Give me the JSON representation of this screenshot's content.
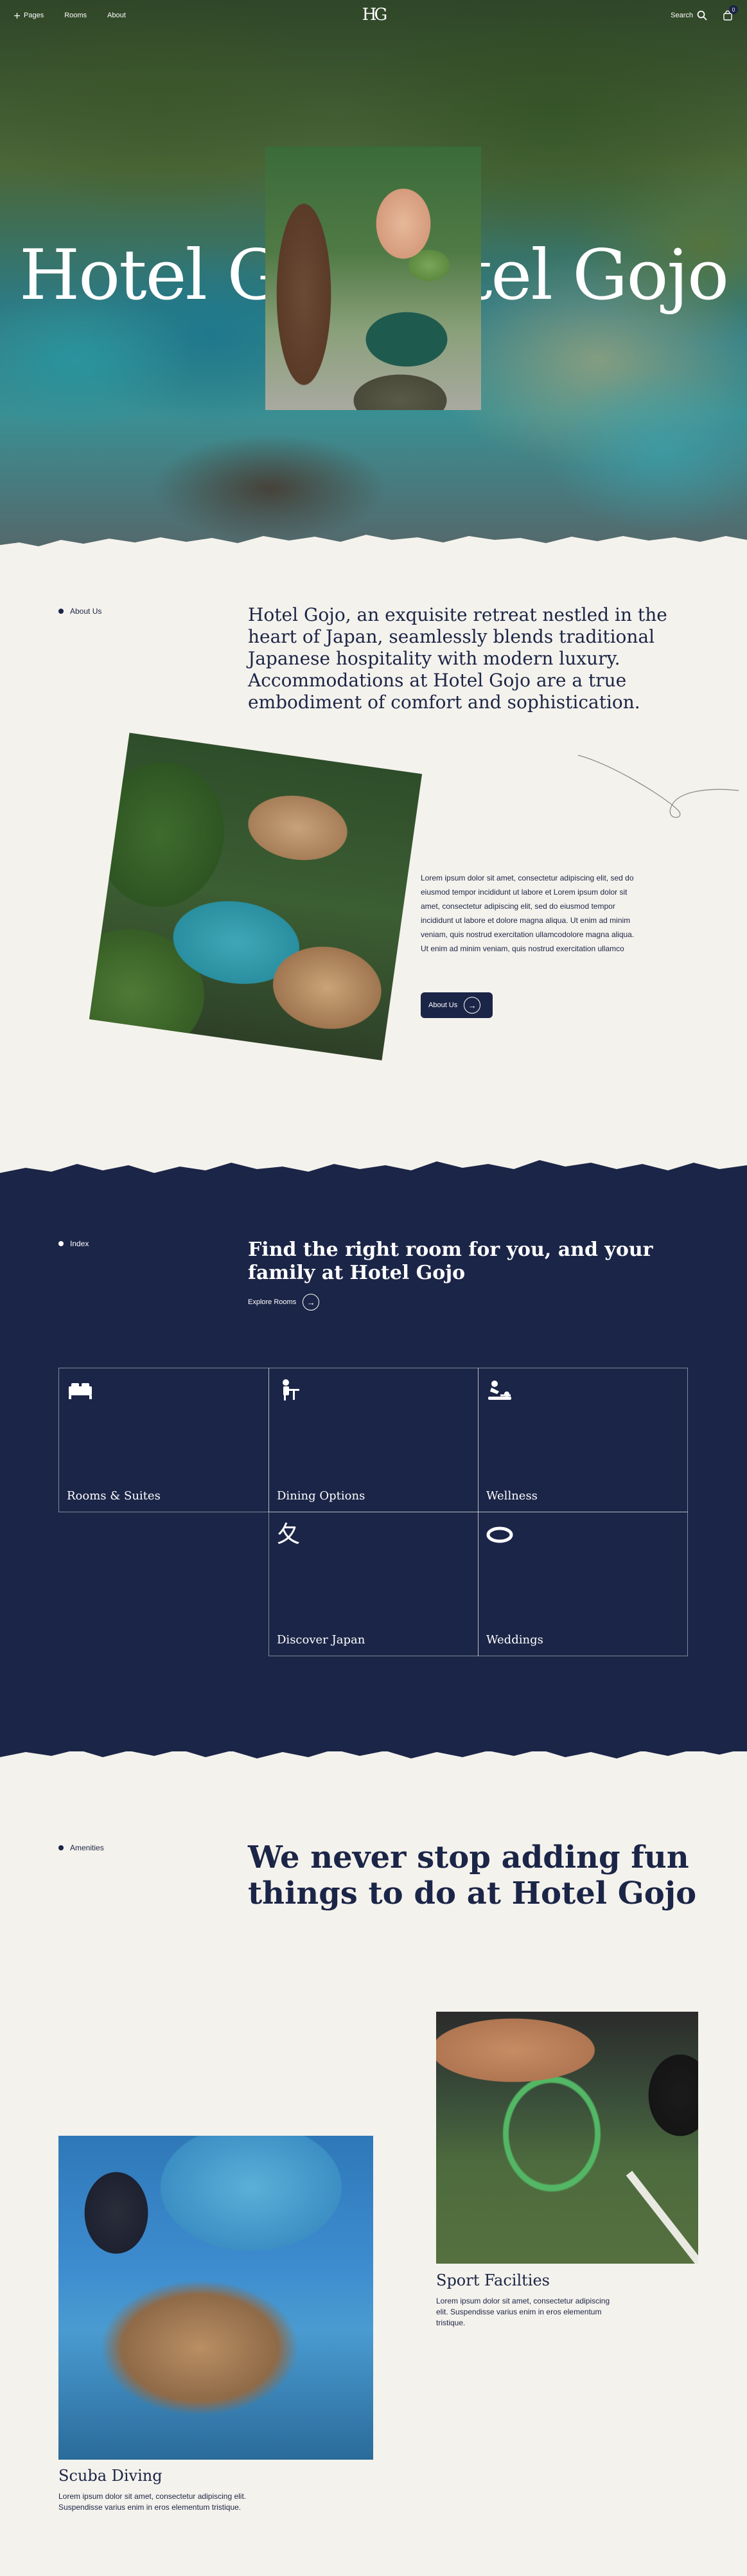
{
  "nav": {
    "pages_label": "Pages",
    "rooms_label": "Rooms",
    "about_label": "About",
    "logo": "HG",
    "search_label": "Search",
    "cart_count": "0"
  },
  "hero": {
    "title_left": "Hotel G",
    "title_right": "tel Gojo"
  },
  "about": {
    "label": "About Us",
    "heading": "Hotel Gojo, an exquisite retreat nestled in the heart of Japan, seamlessly blends traditional Japanese hospitality with modern luxury. Accommodations at Hotel Gojo are a true embodiment of comfort and sophistication.",
    "paragraph": "Lorem ipsum dolor sit amet, consectetur adipiscing elit, sed do eiusmod tempor incididunt ut labore et Lorem ipsum dolor sit amet, consectetur adipiscing elit, sed do eiusmod tempor incididunt ut labore et dolore magna aliqua. Ut enim ad minim veniam, quis nostrud exercitation ullamcodolore magna aliqua. Ut enim ad minim veniam, quis nostrud exercitation ullamco",
    "button_label": "About Us"
  },
  "index": {
    "label": "Index",
    "heading": "Find the right room for you, and your family at Hotel Gojo",
    "explore_label": "Explore Rooms",
    "cells": [
      {
        "label": "Rooms & Suites",
        "icon": "bed-icon"
      },
      {
        "label": "Dining Options",
        "icon": "dining-icon"
      },
      {
        "label": "Wellness",
        "icon": "massage-icon"
      },
      {
        "label": "Discover Japan",
        "icon": "kanji-icon",
        "glyph": "夂"
      },
      {
        "label": "Weddings",
        "icon": "ring-icon"
      }
    ]
  },
  "amenities": {
    "label": "Amenities",
    "heading": "We never stop adding fun things to do at Hotel Gojo",
    "items": [
      {
        "title": "Sport Facilties",
        "text": "Lorem ipsum dolor sit amet, consectetur adipiscing elit. Suspendisse varius enim in eros elementum tristique."
      },
      {
        "title": "Scuba Diving",
        "text": "Lorem ipsum dolor sit amet, consectetur adipiscing elit. Suspendisse varius enim in eros elementum tristique."
      }
    ]
  },
  "colors": {
    "navy": "#1b2547",
    "cream": "#f4f2ec"
  }
}
